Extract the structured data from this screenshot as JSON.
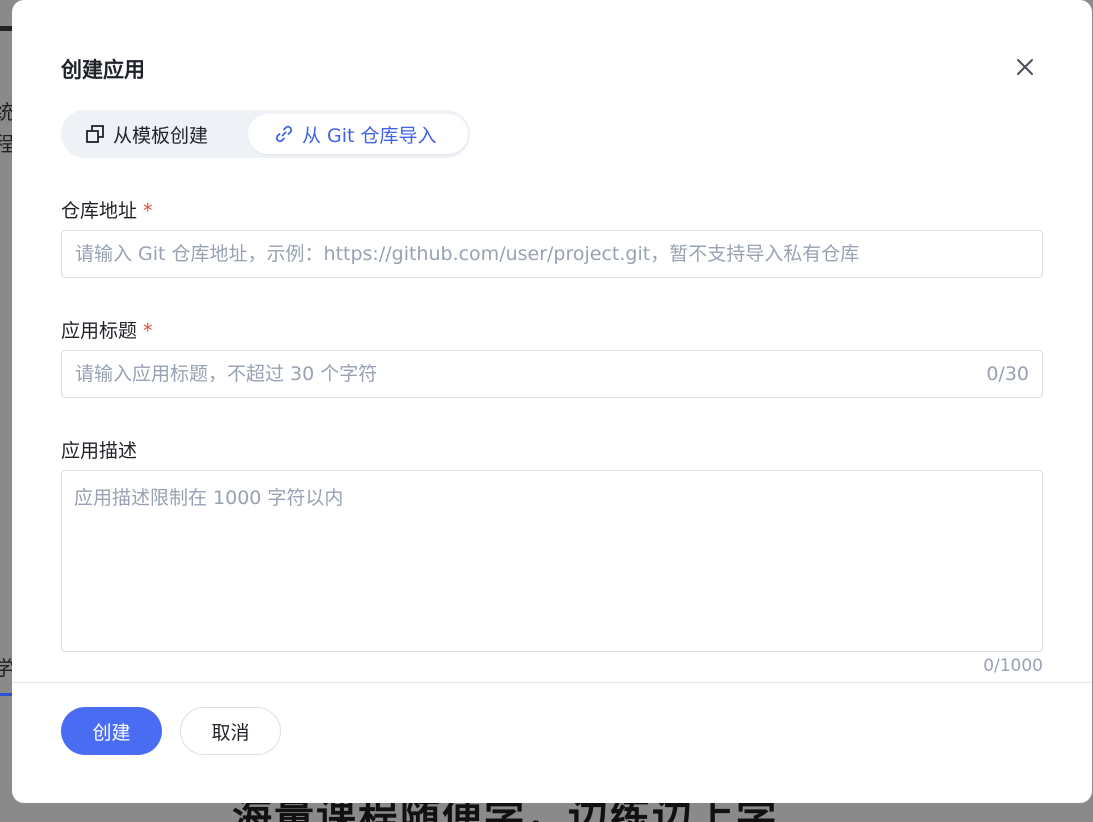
{
  "background": {
    "left_text_1": "统",
    "left_text_2": "程",
    "left_text_3": "学",
    "bottom_heading": "海量课程随便学，边练边上学"
  },
  "modal": {
    "title": "创建应用",
    "close_icon": "close-icon",
    "tabs": [
      {
        "label": "从模板创建",
        "icon": "template-copy-icon",
        "active": false
      },
      {
        "label": "从 Git 仓库导入",
        "icon": "link-icon",
        "active": true
      }
    ],
    "fields": {
      "repo": {
        "label": "仓库地址",
        "required_mark": "*",
        "placeholder": "请输入 Git 仓库地址，示例：https://github.com/user/project.git，暂不支持导入私有仓库",
        "value": ""
      },
      "title": {
        "label": "应用标题",
        "required_mark": "*",
        "placeholder": "请输入应用标题，不超过 30 个字符",
        "value": "",
        "counter": "0/30"
      },
      "description": {
        "label": "应用描述",
        "placeholder": "应用描述限制在 1000 字符以内",
        "value": "",
        "counter": "0/1000"
      }
    },
    "buttons": {
      "create": "创建",
      "cancel": "取消"
    }
  },
  "colors": {
    "primary": "#4a6cf2",
    "active_tab_text": "#3f63ea",
    "required": "#e04b3a"
  }
}
